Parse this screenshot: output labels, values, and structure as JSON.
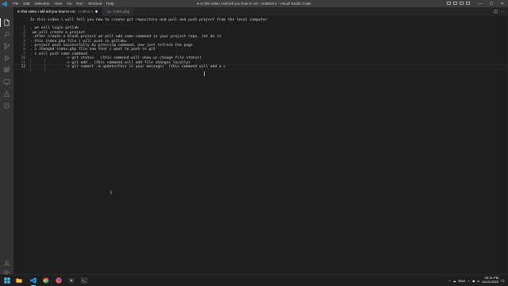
{
  "titlebar": {
    "menu": [
      "File",
      "Edit",
      "Selection",
      "View",
      "Go",
      "Run",
      "Terminal",
      "Help"
    ],
    "window_title": "● In this video i will tell you how to cre - Untitled-1 - Visual Studio Code",
    "controls": {
      "minimize": "—",
      "maximize": "☐",
      "close": "✕"
    }
  },
  "activitybar": {
    "icons": [
      "files-icon",
      "search-icon",
      "source-control-icon",
      "run-debug-icon",
      "extensions-icon",
      "remote-explorer-icon",
      "testing-icon",
      "php-icon",
      "account-icon",
      "settings-gear-icon"
    ]
  },
  "tabs": [
    {
      "label": "In this video i will tell you how to cre",
      "suffix": "Untitled-1",
      "active": true,
      "dirty": true
    },
    {
      "label": "index.php",
      "active": false,
      "dirty": false
    }
  ],
  "editor": {
    "lines": [
      {
        "no": "",
        "text": "In this video i will tell you how to create git repository and pull and push project from the local computer"
      },
      {
        "no": "",
        "text": ""
      },
      {
        "no": "1",
        "text": ". we will login gitlab"
      },
      {
        "no": "2",
        "text": " we will create a project"
      },
      {
        "no": "3",
        "text": " .after create a blank project we will add some command in your project repo. let do it"
      },
      {
        "no": "4",
        "text": ". this index.php file i will push in gitlab="
      },
      {
        "no": "5",
        "text": ". project push successfully by pressing command, now just refresh the page"
      },
      {
        "no": "6",
        "text": ". i changed index.php file now that i want to push in git"
      },
      {
        "no": "7",
        "text": ". i will push some command"
      },
      {
        "no": "10",
        "text": "                -> git status   (this command will show us chnage file status)"
      },
      {
        "no": "11",
        "text": "                -> git add . (this command will add file changes locally)"
      },
      {
        "no": "12",
        "text": "                -> git commit -m update(this is your message)  (this command will add a c"
      }
    ]
  },
  "taskbar": {
    "apps": [
      "windows-start-icon",
      "taskbar-search-icon",
      "file-explorer-icon",
      "vscode-icon",
      "chrome-icon",
      "firefox-icon",
      "media-player-icon",
      "terminal-icon"
    ],
    "tray": {
      "chevron": "^",
      "language": "ENG",
      "time": "02:31 PM",
      "date": "04-02-2023"
    }
  },
  "colors": {
    "editor_bg": "#1e1e1e",
    "titlebar_bg": "#3c3c3c",
    "activitybar_bg": "#333333",
    "accent": "#007acc",
    "taskbar_bg": "#1f1f1f"
  }
}
